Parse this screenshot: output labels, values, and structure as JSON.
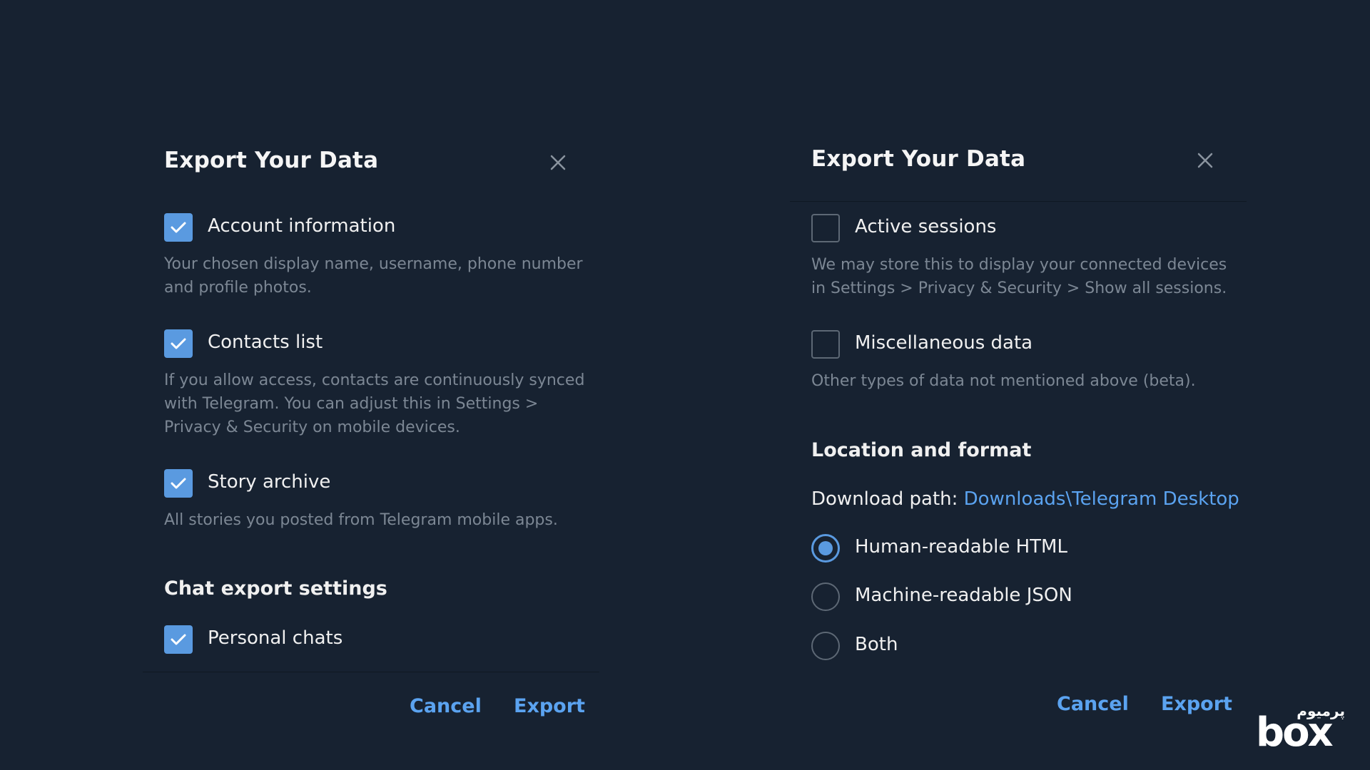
{
  "left_dialog": {
    "title": "Export Your Data",
    "options": [
      {
        "label": "Account information",
        "checked": true,
        "description": "Your chosen display name, username, phone number and profile photos."
      },
      {
        "label": "Contacts list",
        "checked": true,
        "description": "If you allow access, contacts are continuously synced with Telegram. You can adjust this in Settings > Privacy & Security on mobile devices."
      },
      {
        "label": "Story archive",
        "checked": true,
        "description": "All stories you posted from Telegram mobile apps."
      }
    ],
    "section_title": "Chat export settings",
    "chat_option": {
      "label": "Personal chats",
      "checked": true
    },
    "cancel_label": "Cancel",
    "export_label": "Export"
  },
  "right_dialog": {
    "title": "Export Your Data",
    "options": [
      {
        "label": "Active sessions",
        "checked": false,
        "description": "We may store this to display your connected devices in Settings > Privacy & Security > Show all sessions."
      },
      {
        "label": "Miscellaneous data",
        "checked": false,
        "description": "Other types of data not mentioned above (beta)."
      }
    ],
    "section_title": "Location and format",
    "download_path_label": "Download path: ",
    "download_path_value": "Downloads\\Telegram Desktop",
    "formats": [
      {
        "label": "Human-readable HTML",
        "selected": true
      },
      {
        "label": "Machine-readable JSON",
        "selected": false
      },
      {
        "label": "Both",
        "selected": false
      }
    ],
    "cancel_label": "Cancel",
    "export_label": "Export"
  },
  "watermark": {
    "brand": "box",
    "brand_fa": "پرمیوم"
  },
  "colors": {
    "background": "#172231",
    "accent": "#5a9ae0",
    "link": "#5ba3f0",
    "text_primary": "#f0f0f0",
    "text_secondary": "#7c8794"
  },
  "icons": {
    "close": "close-icon",
    "check": "check-icon"
  }
}
